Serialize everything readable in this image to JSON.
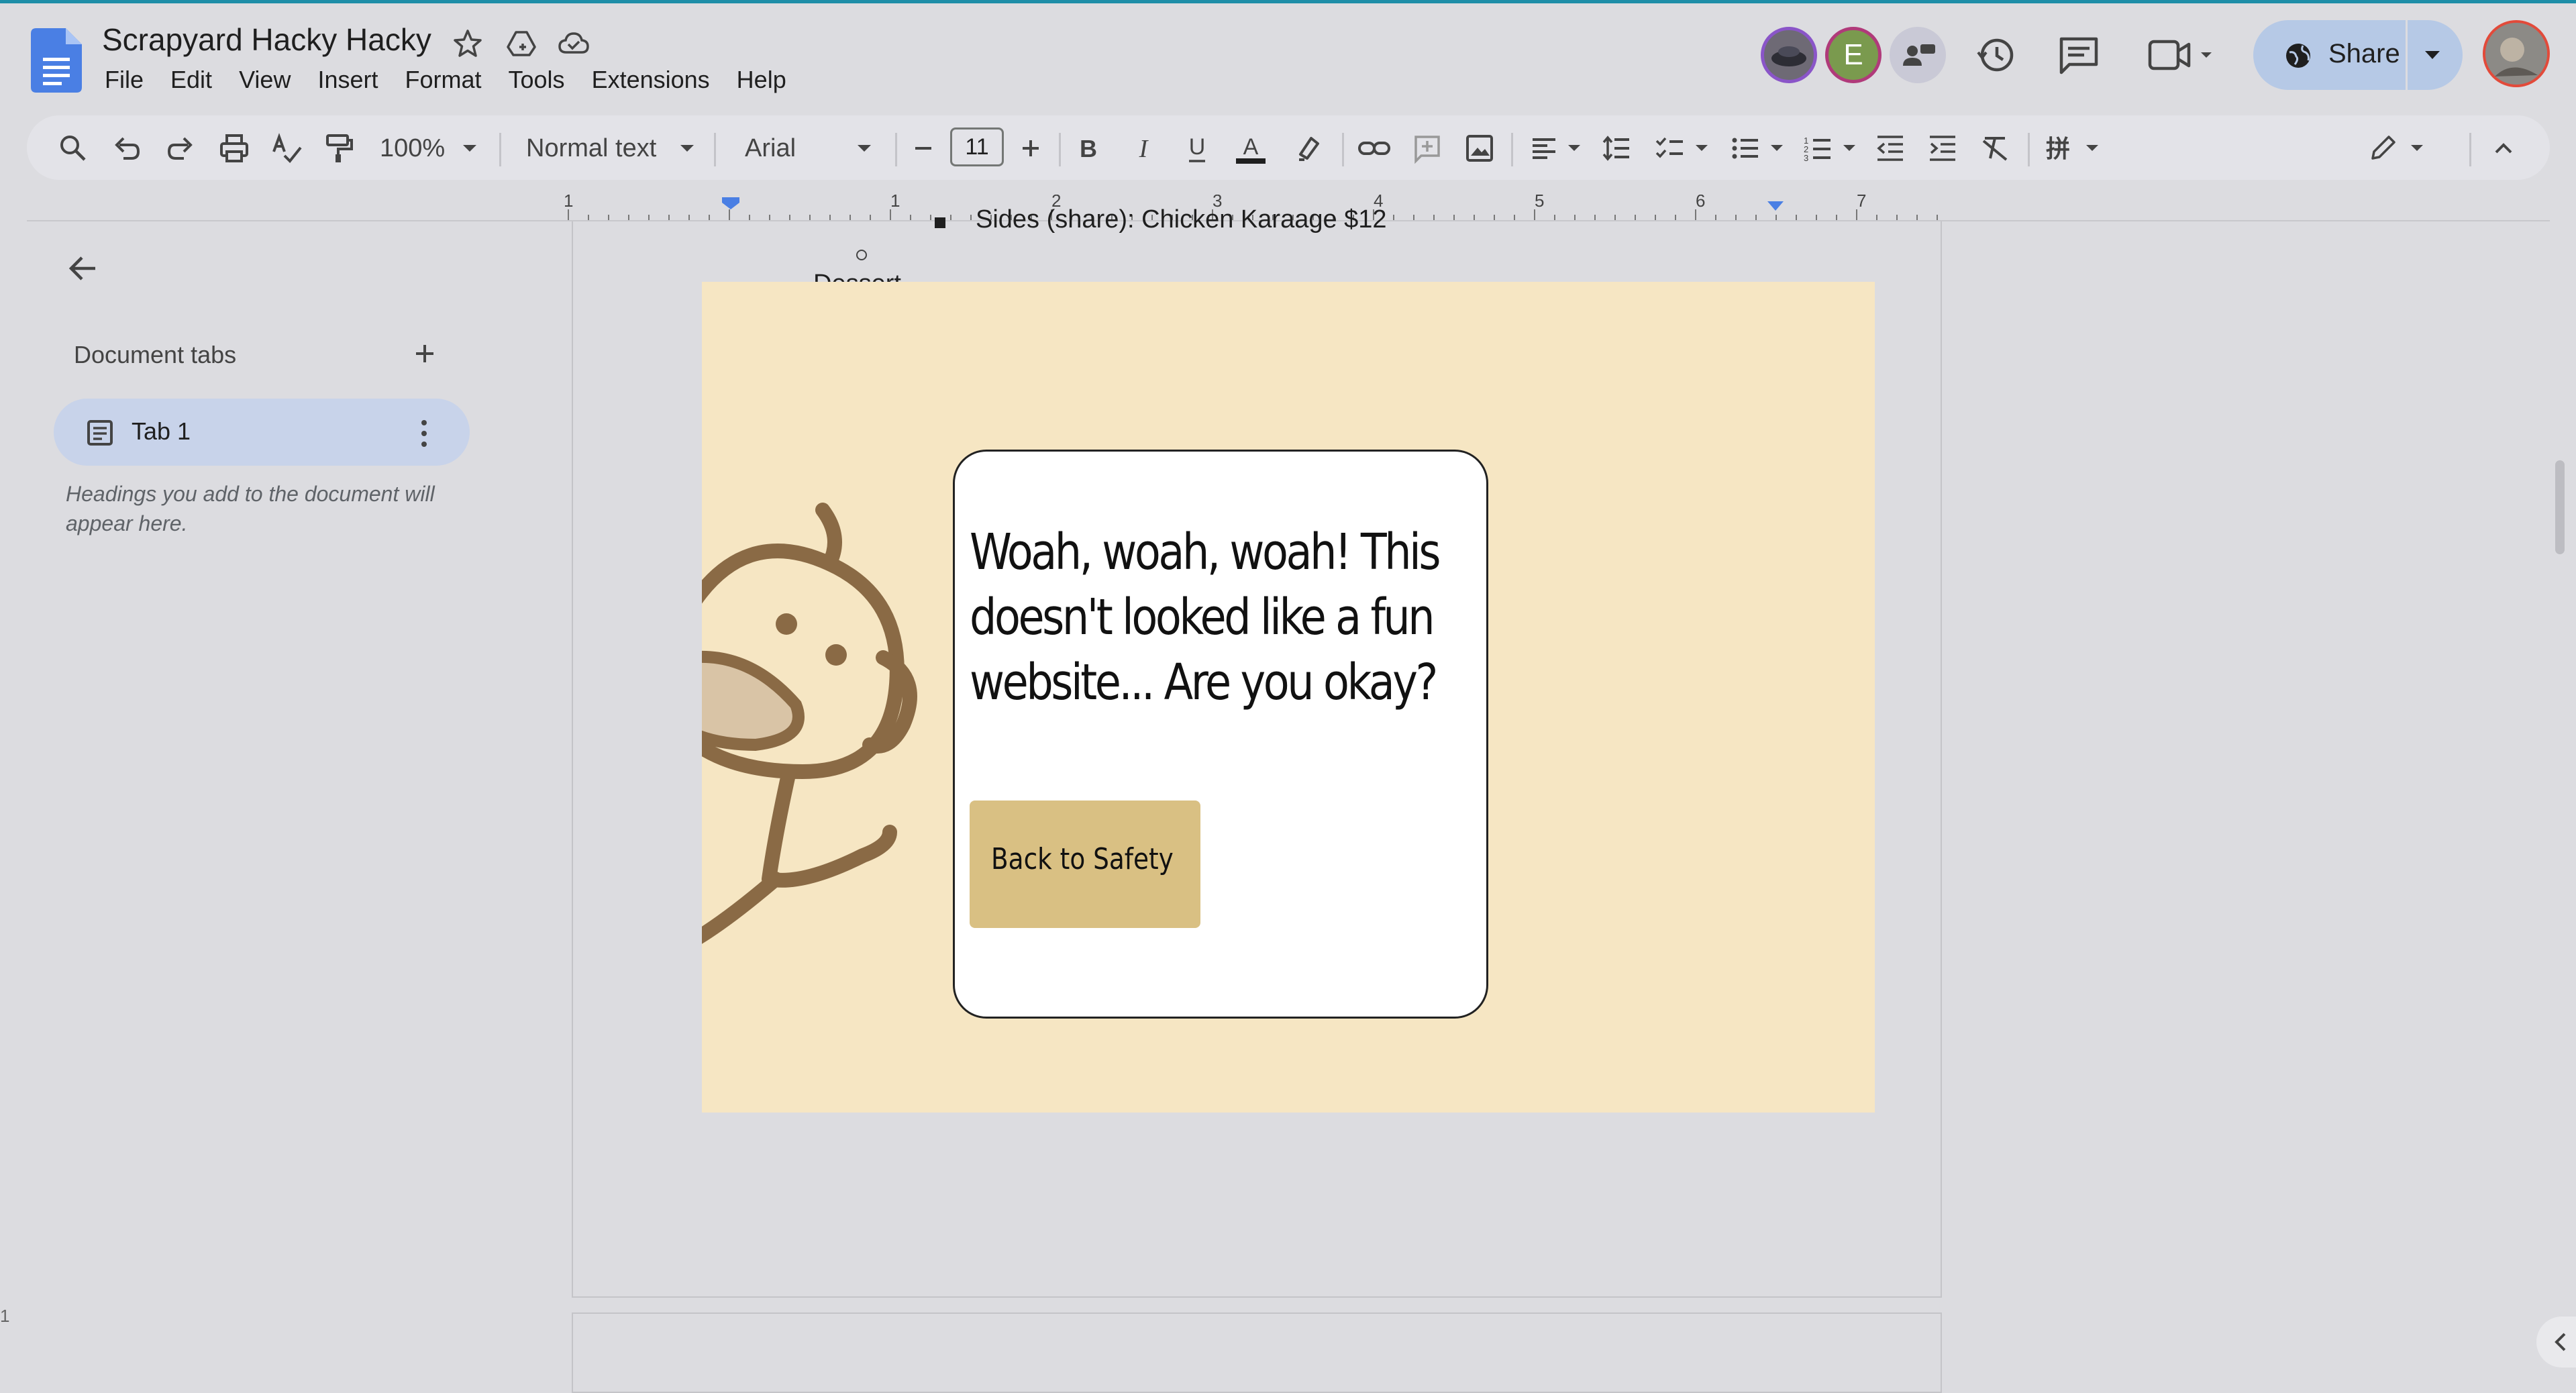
{
  "app": {
    "doc_title": "Scrapyard Hacky Hacky",
    "menu": [
      "File",
      "Edit",
      "View",
      "Insert",
      "Format",
      "Tools",
      "Extensions",
      "Help"
    ],
    "title_icons": [
      "star-icon",
      "move-to-drive-icon",
      "cloud-saved-icon"
    ]
  },
  "header": {
    "avatar_e": "E",
    "share_label": "Share",
    "icons": [
      "history-icon",
      "comments-icon",
      "meet-icon",
      "share-globe-icon"
    ]
  },
  "toolbar": {
    "zoom": "100%",
    "style": "Normal text",
    "font": "Arial",
    "font_size": "11"
  },
  "ruler": {
    "numbers": [
      "1",
      "1",
      "2",
      "3",
      "4",
      "5",
      "6",
      "7"
    ]
  },
  "sidebar": {
    "heading": "Document tabs",
    "tab_label": "Tab 1",
    "hint": "Headings you add to the document will appear here."
  },
  "document": {
    "bullet_line": "Sides (share): Chicken Karaage $12",
    "line_2": "Dessert"
  },
  "overlay": {
    "message": "Woah, woah, woah! This doesn't looked like a fun website... Are you okay?",
    "button_label": "Back to Safety",
    "background_color": "#f6e6c3",
    "button_color": "#d9c083"
  },
  "vertical_ruler": {
    "mark": "1"
  }
}
